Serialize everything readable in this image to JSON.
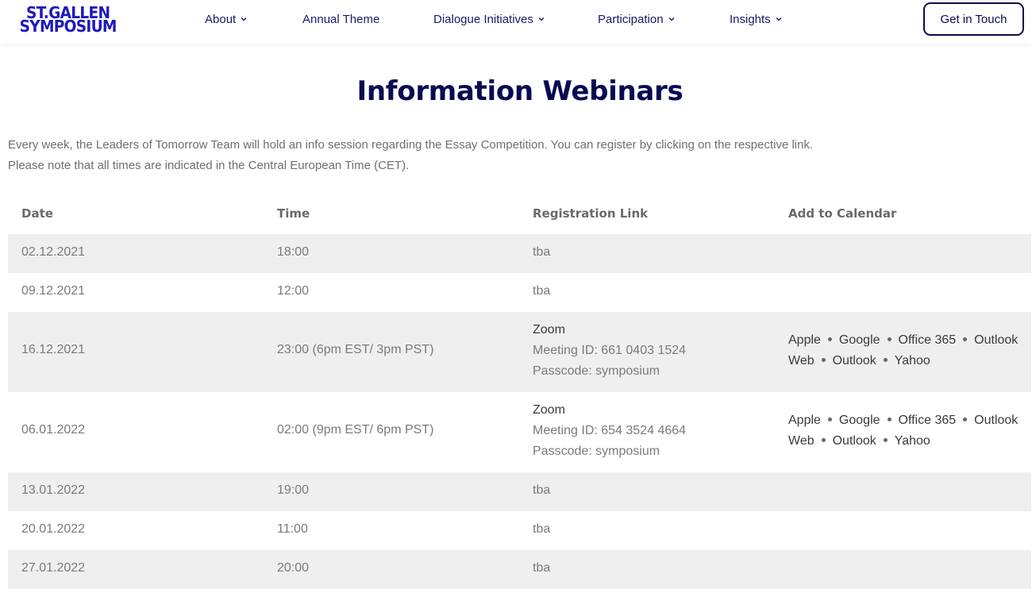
{
  "brand": {
    "line1": "ST.GALLEN",
    "line2": "SYMPOSIUM",
    "color": "#1d1ab8"
  },
  "nav": {
    "items": [
      {
        "label": "About",
        "dropdown": true
      },
      {
        "label": "Annual Theme",
        "dropdown": false
      },
      {
        "label": "Dialogue Initiatives",
        "dropdown": true
      },
      {
        "label": "Participation",
        "dropdown": true
      },
      {
        "label": "Insights",
        "dropdown": true
      }
    ],
    "cta": "Get in Touch"
  },
  "page": {
    "title": "Information Webinars",
    "intro_line1": "Every week, the Leaders of Tomorrow Team will hold an info session regarding the Essay Competition. You can register by clicking on the respective link.",
    "intro_line2": "Please note that all times are indicated in the Central European Time (CET)."
  },
  "table": {
    "headers": [
      "Date",
      "Time",
      "Registration Link",
      "Add to Calendar"
    ],
    "rows": [
      {
        "date": "02.12.2021",
        "time": "18:00",
        "reg": "tba"
      },
      {
        "date": "09.12.2021",
        "time": "12:00",
        "reg": "tba"
      },
      {
        "date": "16.12.2021",
        "time": "23:00 (6pm EST/ 3pm PST)",
        "reg_zoom": "Zoom",
        "reg_meeting": "Meeting ID: 661 0403 1524",
        "reg_pass": "Passcode: symposium",
        "cal": [
          "Apple",
          "Google",
          "Office 365",
          "Outlook",
          "Web",
          "Outlook",
          "Yahoo"
        ]
      },
      {
        "date": "06.01.2022",
        "time": "02:00 (9pm EST/ 6pm PST)",
        "reg_zoom": "Zoom",
        "reg_meeting": "Meeting ID: 654 3524 4664",
        "reg_pass": "Passcode: symposium",
        "cal": [
          "Apple",
          "Google",
          "Office 365",
          "Outlook",
          "Web",
          "Outlook",
          "Yahoo"
        ]
      },
      {
        "date": "13.01.2022",
        "time": "19:00",
        "reg": "tba"
      },
      {
        "date": "20.01.2022",
        "time": "11:00",
        "reg": "tba"
      },
      {
        "date": "27.01.2022",
        "time": "20:00",
        "reg": "tba"
      }
    ]
  },
  "colors": {
    "title": "#0a0a52",
    "nav_text": "#1a1a66",
    "row_shade": "#efefef"
  }
}
